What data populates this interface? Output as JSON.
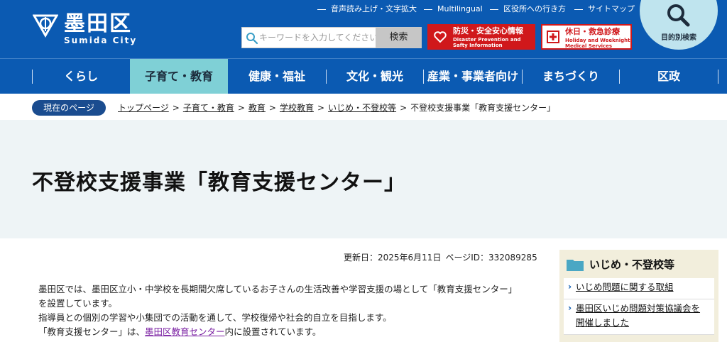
{
  "header": {
    "logo_ja": "墨田区",
    "logo_en": "Sumida City",
    "util_links": [
      "音声読み上げ・文字拡大",
      "Multilingual",
      "区役所への行き方",
      "サイトマップ"
    ],
    "search_placeholder": "キーワードを入力してください",
    "search_button": "検索",
    "disaster_title": "防災・安全安心情報",
    "disaster_sub1": "Disaster Prevention and",
    "disaster_sub2": "Safty Information",
    "holiday_title": "休日・救急診療",
    "holiday_sub1": "Holiday and Weeknight",
    "holiday_sub2": "Medical Services",
    "purpose_label": "目的別検索"
  },
  "nav": [
    "くらし",
    "子育て・教育",
    "健康・福祉",
    "文化・観光",
    "産業・事業者向け",
    "まちづくり",
    "区政"
  ],
  "nav_active": "子育て・教育",
  "breadcrumb": {
    "label": "現在のページ",
    "items": [
      "トップページ",
      "子育て・教育",
      "教育",
      "学校教育",
      "いじめ・不登校等"
    ],
    "current": "不登校支援事業「教育支援センター」"
  },
  "page_title": "不登校支援事業「教育支援センター」",
  "meta": {
    "updated": "更新日：2025年6月11日",
    "page_id": "ページID：332089285"
  },
  "body": {
    "line1": "墨田区では、墨田区立小・中学校を長期間欠席しているお子さんの生活改善や学習支援の場として「教育支援センター」",
    "line2": "を設置しています。",
    "line3": "指導員との個別の学習や小集団での活動を通して、学校復帰や社会的自立を目指します。",
    "line4_pre": "「教育支援センター」は、",
    "line4_link": "墨田区教育センター",
    "line4_post": "内に設置されています。"
  },
  "side": {
    "title": "いじめ・不登校等",
    "items": [
      "いじめ問題に関する取組",
      "墨田区いじめ問題対策協議会を開催しました"
    ]
  },
  "colors": {
    "brand": "#0b5ab2",
    "active_tab": "#7fd0d6",
    "alert_red": "#d0181b"
  }
}
